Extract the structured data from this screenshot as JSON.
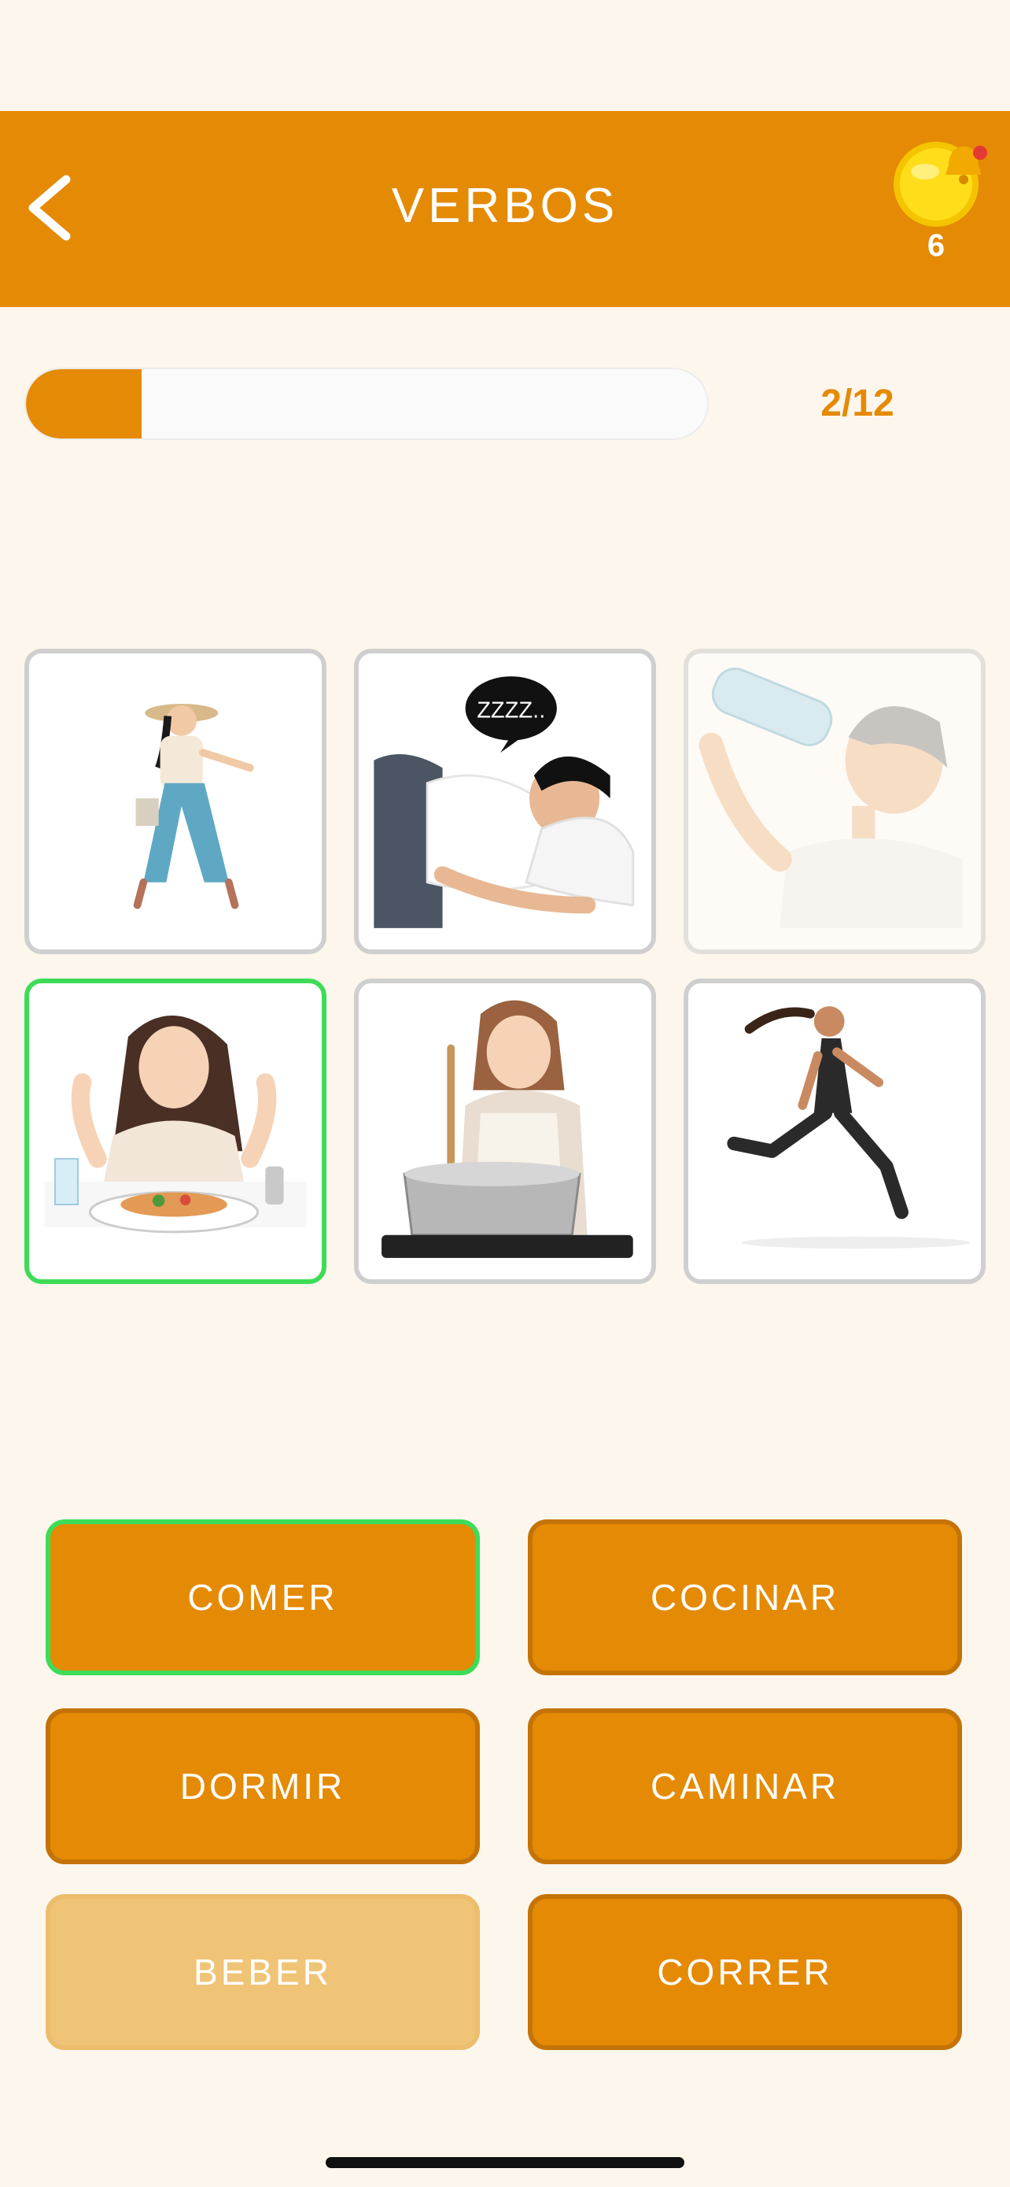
{
  "header": {
    "title": "VERBOS",
    "coins": "6",
    "back_icon": "chevron-left-icon",
    "coin_icon": "coin-icon",
    "bell_icon": "bell-icon"
  },
  "progress": {
    "text": "2/12",
    "fraction": 0.17
  },
  "colors": {
    "accent": "#e58a04",
    "accent_border": "#c47306",
    "selected": "#3ddc58",
    "background": "#fdf6ec",
    "dim_answer": "#f0c477"
  },
  "images": [
    {
      "name": "walking",
      "state": "normal"
    },
    {
      "name": "sleeping",
      "state": "normal",
      "speech": "ZZZZ.."
    },
    {
      "name": "drinking",
      "state": "dim"
    },
    {
      "name": "eating",
      "state": "selected"
    },
    {
      "name": "cooking",
      "state": "normal"
    },
    {
      "name": "running",
      "state": "normal"
    }
  ],
  "answers": [
    {
      "label": "COMER",
      "state": "selected"
    },
    {
      "label": "COCINAR",
      "state": "normal"
    },
    {
      "label": "DORMIR",
      "state": "normal"
    },
    {
      "label": "CAMINAR",
      "state": "normal"
    },
    {
      "label": "BEBER",
      "state": "dim"
    },
    {
      "label": "CORRER",
      "state": "normal"
    }
  ]
}
